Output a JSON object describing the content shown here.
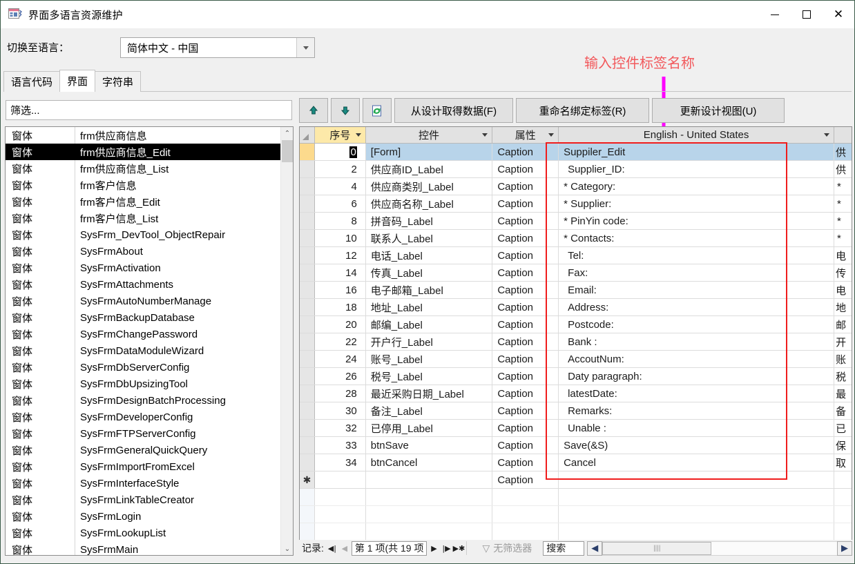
{
  "window": {
    "title": "界面多语言资源维护",
    "icon": "access-form-icon",
    "minimize": "−",
    "maximize": "□",
    "close": "✕"
  },
  "language_bar": {
    "label": "切换至语言：",
    "selected": "简体中文 - 中国",
    "dropdown_icon": "chevron-down-icon"
  },
  "annotation": {
    "text": "输入控件标签名称",
    "color": "#f2595c",
    "arrow_color": "#ff00ff"
  },
  "tabs": [
    {
      "label": "语言代码",
      "active": false
    },
    {
      "label": "界面",
      "active": true
    },
    {
      "label": "字符串",
      "active": false
    }
  ],
  "filter": {
    "placeholder": "筛选...",
    "value": "筛选..."
  },
  "object_list": {
    "selected_index": 1,
    "items": [
      {
        "type": "窗体",
        "name": "frm供应商信息"
      },
      {
        "type": "窗体",
        "name": "frm供应商信息_Edit"
      },
      {
        "type": "窗体",
        "name": "frm供应商信息_List"
      },
      {
        "type": "窗体",
        "name": "frm客户信息"
      },
      {
        "type": "窗体",
        "name": "frm客户信息_Edit"
      },
      {
        "type": "窗体",
        "name": "frm客户信息_List"
      },
      {
        "type": "窗体",
        "name": "SysFrm_DevTool_ObjectRepair"
      },
      {
        "type": "窗体",
        "name": "SysFrmAbout"
      },
      {
        "type": "窗体",
        "name": "SysFrmActivation"
      },
      {
        "type": "窗体",
        "name": "SysFrmAttachments"
      },
      {
        "type": "窗体",
        "name": "SysFrmAutoNumberManage"
      },
      {
        "type": "窗体",
        "name": "SysFrmBackupDatabase"
      },
      {
        "type": "窗体",
        "name": "SysFrmChangePassword"
      },
      {
        "type": "窗体",
        "name": "SysFrmDataModuleWizard"
      },
      {
        "type": "窗体",
        "name": "SysFrmDbServerConfig"
      },
      {
        "type": "窗体",
        "name": "SysFrmDbUpsizingTool"
      },
      {
        "type": "窗体",
        "name": "SysFrmDesignBatchProcessing"
      },
      {
        "type": "窗体",
        "name": "SysFrmDeveloperConfig"
      },
      {
        "type": "窗体",
        "name": "SysFrmFTPServerConfig"
      },
      {
        "type": "窗体",
        "name": "SysFrmGeneralQuickQuery"
      },
      {
        "type": "窗体",
        "name": "SysFrmImportFromExcel"
      },
      {
        "type": "窗体",
        "name": "SysFrmInterfaceStyle"
      },
      {
        "type": "窗体",
        "name": "SysFrmLinkTableCreator"
      },
      {
        "type": "窗体",
        "name": "SysFrmLogin"
      },
      {
        "type": "窗体",
        "name": "SysFrmLookupList"
      },
      {
        "type": "窗体",
        "name": "SysFrmMain"
      }
    ],
    "scroll_up_icon": "chevron-up-icon",
    "scroll_down_icon": "chevron-down-icon"
  },
  "toolbar": {
    "move_up_icon": "arrow-up-icon",
    "move_down_icon": "arrow-down-icon",
    "refresh_icon": "refresh-document-icon",
    "get_from_design": "从设计取得数据(F)",
    "rename_bound_label": "重命名绑定标签(R)",
    "update_design_view": "更新设计视图(U)"
  },
  "grid": {
    "columns": [
      {
        "label": "序号",
        "sorted": true
      },
      {
        "label": "控件",
        "sorted": false
      },
      {
        "label": "属性",
        "sorted": false
      },
      {
        "label": "English - United States",
        "sorted": false
      }
    ],
    "selected_row": 0,
    "selected_cell_value": "0",
    "rows": [
      {
        "seq": "0",
        "control": "[Form]",
        "prop": "Caption",
        "en": "Suppiler_Edit",
        "zh": "供"
      },
      {
        "seq": "2",
        "control": "供应商ID_Label",
        "prop": "Caption",
        "en": "Supplier_ID:",
        "zh": "供"
      },
      {
        "seq": "4",
        "control": "供应商类别_Label",
        "prop": "Caption",
        "en": "* Category:",
        "zh": "*"
      },
      {
        "seq": "6",
        "control": "供应商名称_Label",
        "prop": "Caption",
        "en": "* Supplier:",
        "zh": "*"
      },
      {
        "seq": "8",
        "control": "拼音码_Label",
        "prop": "Caption",
        "en": "* PinYin code:",
        "zh": "*"
      },
      {
        "seq": "10",
        "control": "联系人_Label",
        "prop": "Caption",
        "en": "* Contacts:",
        "zh": "*"
      },
      {
        "seq": "12",
        "control": "电话_Label",
        "prop": "Caption",
        "en": "Tel:",
        "zh": "电"
      },
      {
        "seq": "14",
        "control": "传真_Label",
        "prop": "Caption",
        "en": "Fax:",
        "zh": "传"
      },
      {
        "seq": "16",
        "control": "电子邮箱_Label",
        "prop": "Caption",
        "en": "Email:",
        "zh": "电"
      },
      {
        "seq": "18",
        "control": "地址_Label",
        "prop": "Caption",
        "en": "Address:",
        "zh": "地"
      },
      {
        "seq": "20",
        "control": "邮编_Label",
        "prop": "Caption",
        "en": "Postcode:",
        "zh": "邮"
      },
      {
        "seq": "22",
        "control": "开户行_Label",
        "prop": "Caption",
        "en": "Bank :",
        "zh": "开"
      },
      {
        "seq": "24",
        "control": "账号_Label",
        "prop": "Caption",
        "en": "AccoutNum:",
        "zh": "账"
      },
      {
        "seq": "26",
        "control": "税号_Label",
        "prop": "Caption",
        "en": "Daty paragraph:",
        "zh": "税"
      },
      {
        "seq": "28",
        "control": "最近采购日期_Label",
        "prop": "Caption",
        "en": "latestDate:",
        "zh": "最"
      },
      {
        "seq": "30",
        "control": "备注_Label",
        "prop": "Caption",
        "en": "Remarks:",
        "zh": "备"
      },
      {
        "seq": "32",
        "control": "已停用_Label",
        "prop": "Caption",
        "en": "Unable :",
        "zh": "已"
      },
      {
        "seq": "33",
        "control": "btnSave",
        "prop": "Caption",
        "en": "Save(&S)",
        "zh": "保"
      },
      {
        "seq": "34",
        "control": "btnCancel",
        "prop": "Caption",
        "en": "Cancel",
        "zh": "取"
      }
    ],
    "new_row_marker": "✱",
    "new_row_prop": "Caption"
  },
  "record_nav": {
    "label": "记录:",
    "first_icon": "first-record-icon",
    "prev_icon": "prev-record-icon",
    "current": "第 1 项(共 19 项",
    "next_icon": "next-record-icon",
    "last_icon": "last-record-icon",
    "new_icon": "new-record-icon",
    "filter_icon": "filter-icon",
    "filter_label": "无筛选器",
    "search_label": "搜索",
    "hscroll_left_icon": "scroll-left-icon",
    "hscroll_right_icon": "scroll-right-icon"
  }
}
